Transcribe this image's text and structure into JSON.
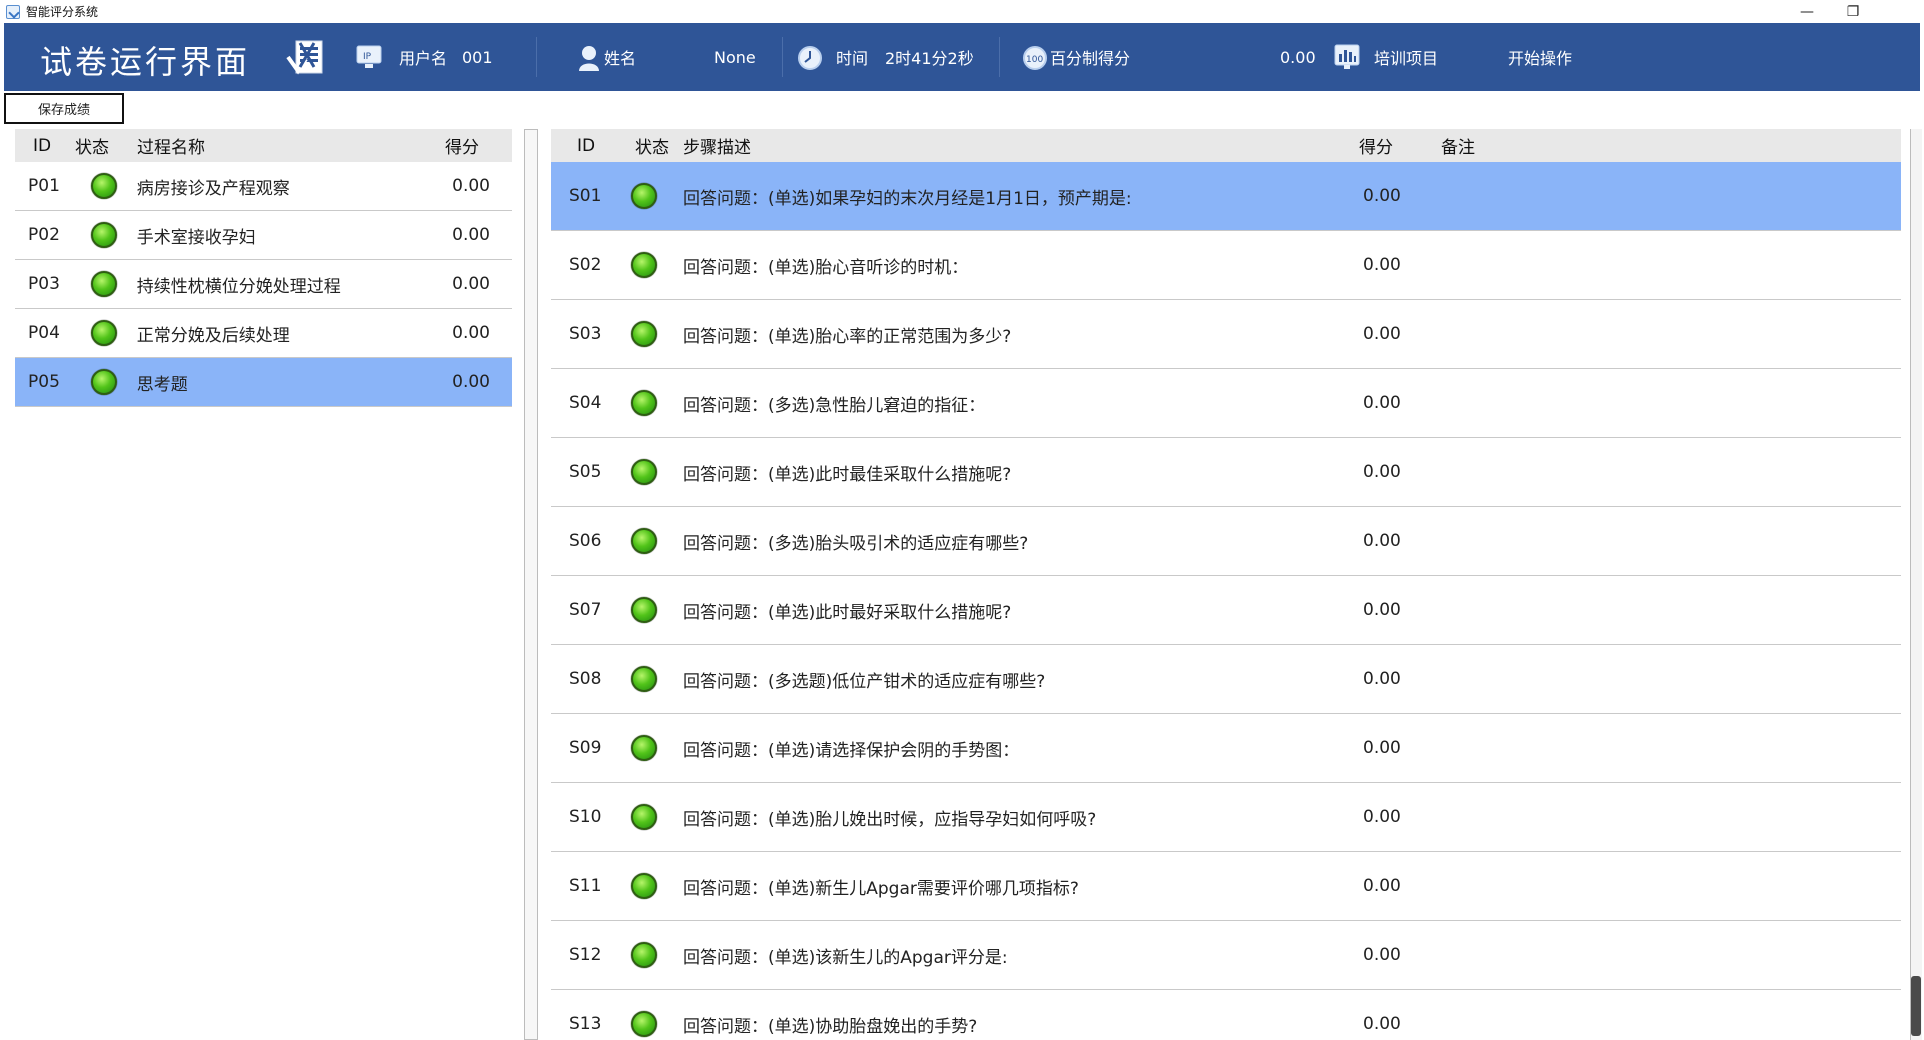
{
  "window": {
    "title": "智能评分系统",
    "minimize": "—",
    "restore": "❐"
  },
  "header": {
    "title": "试卷运行界面",
    "username_label": "用户名",
    "username_value": "001",
    "name_label": "姓名",
    "name_value": "None",
    "time_label": "时间",
    "time_value": "2时41分2秒",
    "score_label": "百分制得分",
    "score_value": "0.00",
    "project_label": "培训项目",
    "project_value": "开始操作"
  },
  "save_button": "保存成绩",
  "process_table": {
    "columns": [
      "ID",
      "状态",
      "过程名称",
      "得分"
    ],
    "rows": [
      {
        "id": "P01",
        "name": "病房接诊及产程观察",
        "score": "0.00"
      },
      {
        "id": "P02",
        "name": "手术室接收孕妇",
        "score": "0.00"
      },
      {
        "id": "P03",
        "name": "持续性枕横位分娩处理过程",
        "score": "0.00"
      },
      {
        "id": "P04",
        "name": "正常分娩及后续处理",
        "score": "0.00"
      },
      {
        "id": "P05",
        "name": "思考题",
        "score": "0.00"
      }
    ],
    "selected_index": 4
  },
  "step_table": {
    "columns": [
      "ID",
      "状态",
      "步骤描述",
      "得分",
      "备注"
    ],
    "rows": [
      {
        "id": "S01",
        "desc": "回答问题：(单选)如果孕妇的末次月经是1月1日，预产期是:",
        "score": "0.00",
        "note": ""
      },
      {
        "id": "S02",
        "desc": "回答问题：(单选)胎心音听诊的时机：",
        "score": "0.00",
        "note": ""
      },
      {
        "id": "S03",
        "desc": "回答问题：(单选)胎心率的正常范围为多少?",
        "score": "0.00",
        "note": ""
      },
      {
        "id": "S04",
        "desc": "回答问题：(多选)急性胎儿窘迫的指征：",
        "score": "0.00",
        "note": ""
      },
      {
        "id": "S05",
        "desc": "回答问题：(单选)此时最佳采取什么措施呢?",
        "score": "0.00",
        "note": ""
      },
      {
        "id": "S06",
        "desc": "回答问题：(多选)胎头吸引术的适应症有哪些?",
        "score": "0.00",
        "note": ""
      },
      {
        "id": "S07",
        "desc": "回答问题：(单选)此时最好采取什么措施呢?",
        "score": "0.00",
        "note": ""
      },
      {
        "id": "S08",
        "desc": "回答问题：(多选题)低位产钳术的适应症有哪些?",
        "score": "0.00",
        "note": ""
      },
      {
        "id": "S09",
        "desc": "回答问题：(单选)请选择保护会阴的手势图：",
        "score": "0.00",
        "note": ""
      },
      {
        "id": "S10",
        "desc": "回答问题：(单选)胎儿娩出时候，应指导孕妇如何呼吸?",
        "score": "0.00",
        "note": ""
      },
      {
        "id": "S11",
        "desc": "回答问题：(单选)新生儿Apgar需要评价哪几项指标?",
        "score": "0.00",
        "note": ""
      },
      {
        "id": "S12",
        "desc": "回答问题：(单选)该新生儿的Apgar评分是:",
        "score": "0.00",
        "note": ""
      },
      {
        "id": "S13",
        "desc": "回答问题：(单选)协助胎盘娩出的手势?",
        "score": "0.00",
        "note": ""
      }
    ],
    "selected_index": 0
  },
  "colors": {
    "header_bg": "#2f5597",
    "selected_row": "#8ab4f8",
    "status_led": "#52c41a"
  },
  "icons": {
    "app": "app-check-icon",
    "exam": "exam-sheet-icon",
    "ip": "ip-monitor-icon",
    "user": "user-icon",
    "clock": "clock-icon",
    "score": "score-100-icon",
    "chart": "bar-chart-icon",
    "status": "status-led-icon"
  }
}
